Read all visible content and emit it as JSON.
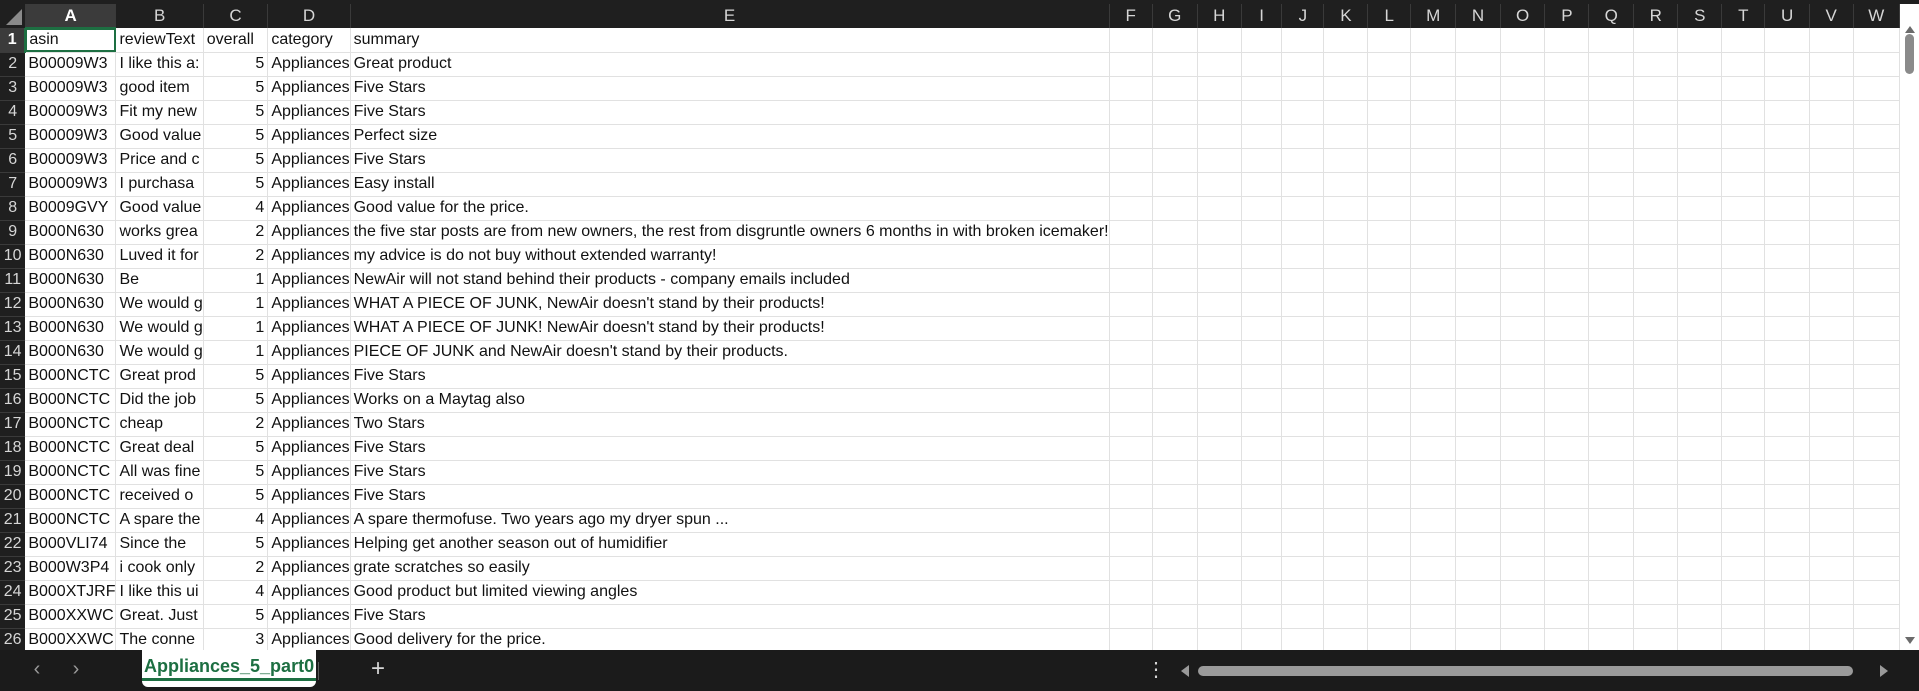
{
  "columns": [
    "A",
    "B",
    "C",
    "D",
    "E",
    "F",
    "G",
    "H",
    "I",
    "J",
    "K",
    "L",
    "M",
    "N",
    "O",
    "P",
    "Q",
    "R",
    "S",
    "T",
    "U",
    "V",
    "W"
  ],
  "selected_column": "A",
  "rows": [
    {
      "num": "1",
      "a": "asin",
      "b": "reviewText",
      "c": "overall",
      "d": "category",
      "e": "summary"
    },
    {
      "num": "2",
      "a": "B00009W3",
      "b": "I like this a:",
      "c": "5",
      "d": "Appliances",
      "e": "Great product"
    },
    {
      "num": "3",
      "a": "B00009W3",
      "b": "good item",
      "c": "5",
      "d": "Appliances",
      "e": "Five Stars"
    },
    {
      "num": "4",
      "a": "B00009W3",
      "b": "Fit my new",
      "c": "5",
      "d": "Appliances",
      "e": "Five Stars"
    },
    {
      "num": "5",
      "a": "B00009W3",
      "b": "Good value",
      "c": "5",
      "d": "Appliances",
      "e": "Perfect size"
    },
    {
      "num": "6",
      "a": "B00009W3",
      "b": "Price and c",
      "c": "5",
      "d": "Appliances",
      "e": "Five Stars"
    },
    {
      "num": "7",
      "a": "B00009W3",
      "b": "I purchasa",
      "c": "5",
      "d": "Appliances",
      "e": "Easy install"
    },
    {
      "num": "8",
      "a": "B0009GVY",
      "b": "Good value",
      "c": "4",
      "d": "Appliances",
      "e": "Good value for the price."
    },
    {
      "num": "9",
      "a": "B000N630",
      "b": "works grea",
      "c": "2",
      "d": "Appliances",
      "e": "the five star posts are from new owners, the rest from disgruntle owners 6 months in with broken icemaker!"
    },
    {
      "num": "10",
      "a": "B000N630",
      "b": "Luved it for",
      "c": "2",
      "d": "Appliances",
      "e": "my advice is do not buy without  extended warranty!"
    },
    {
      "num": "11",
      "a": "B000N630",
      "b": "Be",
      "c": "1",
      "d": "Appliances",
      "e": "NewAir will not stand behind their products - company emails included"
    },
    {
      "num": "12",
      "a": "B000N630",
      "b": "We would g",
      "c": "1",
      "d": "Appliances",
      "e": "WHAT A PIECE OF JUNK, NewAir doesn't stand by their products!"
    },
    {
      "num": "13",
      "a": "B000N630",
      "b": "We would g",
      "c": "1",
      "d": "Appliances",
      "e": "WHAT A PIECE OF JUNK! NewAir doesn't stand by their products!"
    },
    {
      "num": "14",
      "a": "B000N630",
      "b": "We would g",
      "c": "1",
      "d": "Appliances",
      "e": "PIECE OF JUNK and NewAir doesn't stand by their products."
    },
    {
      "num": "15",
      "a": "B000NCTC",
      "b": "Great prod",
      "c": "5",
      "d": "Appliances",
      "e": "Five Stars"
    },
    {
      "num": "16",
      "a": "B000NCTC",
      "b": "Did the job",
      "c": "5",
      "d": "Appliances",
      "e": "Works on a Maytag also"
    },
    {
      "num": "17",
      "a": "B000NCTC",
      "b": "cheap",
      "c": "2",
      "d": "Appliances",
      "e": "Two Stars"
    },
    {
      "num": "18",
      "a": "B000NCTC",
      "b": "Great deal",
      "c": "5",
      "d": "Appliances",
      "e": "Five Stars"
    },
    {
      "num": "19",
      "a": "B000NCTC",
      "b": "All was fine",
      "c": "5",
      "d": "Appliances",
      "e": "Five Stars"
    },
    {
      "num": "20",
      "a": "B000NCTC",
      "b": "received o",
      "c": "5",
      "d": "Appliances",
      "e": "Five Stars"
    },
    {
      "num": "21",
      "a": "B000NCTC",
      "b": "A spare the",
      "c": "4",
      "d": "Appliances",
      "e": "A spare thermofuse. Two years ago my dryer spun ..."
    },
    {
      "num": "22",
      "a": "B000VLI74",
      "b": "Since the",
      "c": "5",
      "d": "Appliances",
      "e": "Helping get another season out of humidifier"
    },
    {
      "num": "23",
      "a": "B000W3P4",
      "b": "i cook only",
      "c": "2",
      "d": "Appliances",
      "e": "grate scratches so easily"
    },
    {
      "num": "24",
      "a": "B000XTJRF",
      "b": "I like this ui",
      "c": "4",
      "d": "Appliances",
      "e": "Good product but limited viewing angles"
    },
    {
      "num": "25",
      "a": "B000XXWC",
      "b": "Great. Just",
      "c": "5",
      "d": "Appliances",
      "e": "Five Stars"
    },
    {
      "num": "26",
      "a": "B000XXWC",
      "b": "The conne",
      "c": "3",
      "d": "Appliances",
      "e": "Good delivery for the price."
    }
  ],
  "sheet_tab": {
    "label": "Appliances_5_part0"
  },
  "nav": {
    "prev": "‹",
    "next": "›",
    "add": "+",
    "more": "⋮"
  },
  "colors": {
    "accent": "#1d6f42",
    "header_bg": "#1f1f1f",
    "gridline": "#e1e1e1"
  }
}
